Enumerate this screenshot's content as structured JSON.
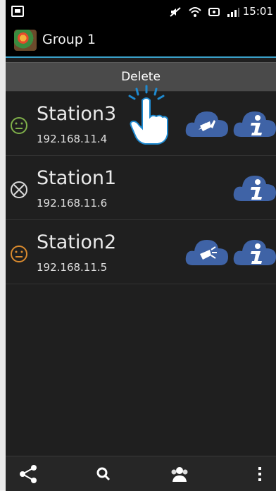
{
  "status_bar": {
    "time": "15:01",
    "icons": [
      "notification-icon",
      "mute-icon",
      "wifi-icon",
      "nfc-icon",
      "signal-icon"
    ]
  },
  "action_bar": {
    "title": "Group 1",
    "logo_icon": "app-logo"
  },
  "delete_bar": {
    "label": "Delete"
  },
  "stations": [
    {
      "name": "Station3",
      "ip": "192.168.11.4",
      "status_icon": "neutral-face-icon",
      "status_color": "#7fb04a",
      "has_speaker": true
    },
    {
      "name": "Station1",
      "ip": "192.168.11.6",
      "status_icon": "offline-x-icon",
      "status_color": "#d8d8d8",
      "has_speaker": false
    },
    {
      "name": "Station2",
      "ip": "192.168.11.5",
      "status_icon": "neutral-face-icon",
      "status_color": "#d98a2e",
      "has_speaker": true
    }
  ],
  "bottom_nav": [
    "share-icon",
    "search-icon",
    "group-icon",
    "overflow-menu-icon"
  ],
  "colors": {
    "accent": "#3aa0c8",
    "cloud": "#3f63a6",
    "background": "#1f1f1f"
  }
}
